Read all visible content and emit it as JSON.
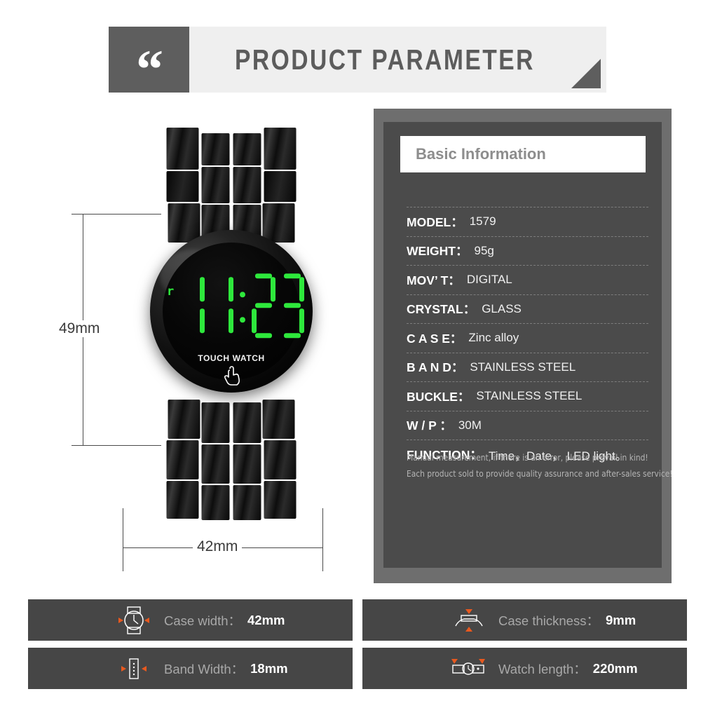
{
  "header": {
    "quote_glyph": "“",
    "title": "PRODUCT PARAMETER"
  },
  "product_image": {
    "brand_text": "TOUCH WATCH",
    "led_indicator": "r",
    "led_time": "11:23",
    "led_digits": [
      "1",
      "1",
      "2",
      "3"
    ],
    "led_color": "#2ee83c",
    "dimensions": {
      "height_label": "49mm",
      "width_label": "42mm"
    }
  },
  "spec_panel": {
    "title": "Basic Information",
    "rows": [
      {
        "key": "MODEL：",
        "value": "1579"
      },
      {
        "key": "WEIGHT：",
        "value": "95g"
      },
      {
        "key": "MOV’ T：",
        "value": "DIGITAL"
      },
      {
        "key": "CRYSTAL：",
        "value": "GLASS"
      },
      {
        "key": "C A S E：",
        "value": "Zinc alloy"
      },
      {
        "key": "B A N D：",
        "value": "STAINLESS STEEL"
      },
      {
        "key": "BUCKLE：",
        "value": "STAINLESS STEEL"
      },
      {
        "key": "W / P ：",
        "value": "30M"
      },
      {
        "key": "FUNCTION：",
        "value": "Time，Date， LED light。"
      }
    ],
    "note_line1": "Manual measurement, if there is an error, please prevail in kind!",
    "note_line2": "Each product sold to provide quality assurance and after-sales service!"
  },
  "features": [
    {
      "icon": "watch-face-icon",
      "label": "Case width：",
      "value": "42mm"
    },
    {
      "icon": "watch-thickness-icon",
      "label": "Case thickness：",
      "value": "9mm"
    },
    {
      "icon": "band-width-icon",
      "label": "Band Width：",
      "value": "18mm"
    },
    {
      "icon": "watch-length-icon",
      "label": "Watch length：",
      "value": "220mm"
    }
  ],
  "colors": {
    "accent_orange": "#e8591f",
    "panel_frame": "#6e6e6e",
    "panel_bg": "#4b4b4b",
    "bar_bg": "#464646",
    "header_bg": "#efefef",
    "header_dark": "#5e5e5e",
    "led_green": "#2ee83c"
  }
}
